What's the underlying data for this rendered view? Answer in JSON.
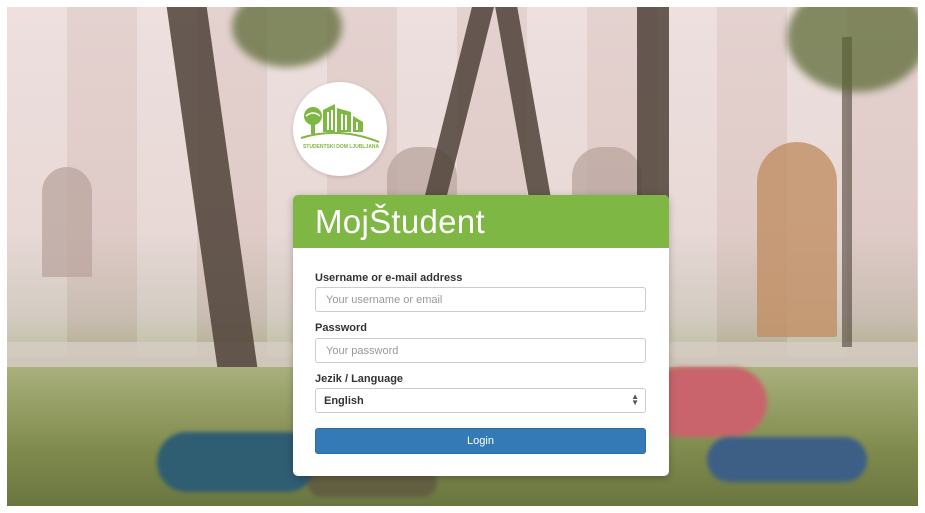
{
  "logo": {
    "icon": "student-dorm-logo-icon",
    "text": "STUDENTSKI DOM LJUBLJANA"
  },
  "header": {
    "title": "MojŠtudent",
    "color": "#7fb745"
  },
  "form": {
    "username_label": "Username or e-mail address",
    "username_placeholder": "Your username or email",
    "password_label": "Password",
    "password_placeholder": "Your password",
    "language_label": "Jezik / Language",
    "language_selected": "English",
    "login_label": "Login",
    "login_color": "#337ab7"
  }
}
